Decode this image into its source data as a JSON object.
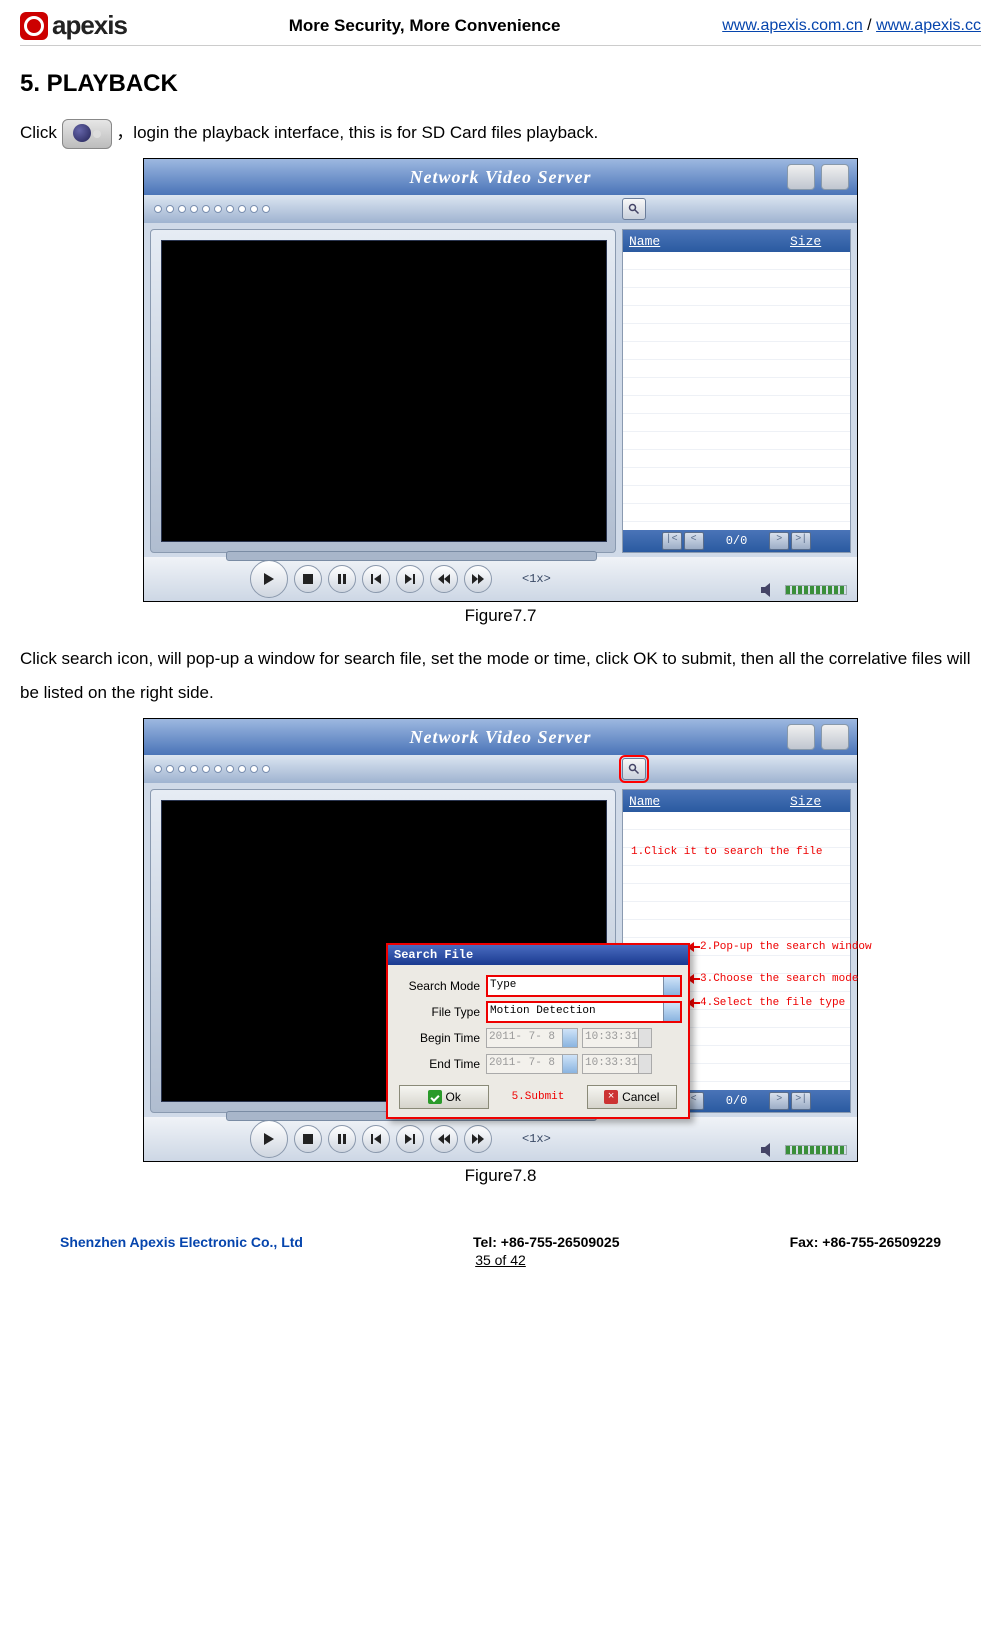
{
  "header": {
    "brand": "apexis",
    "slogan": "More Security, More Convenience",
    "link1": "www.apexis.com.cn",
    "sep": " / ",
    "link2": "www.apexis.cc"
  },
  "title": "5. PLAYBACK",
  "para1_pre": "Click",
  "para1_post": "，login the playback interface, this is for SD Card files playback.",
  "fig1": {
    "app_title": "Network Video Server",
    "col_name": "Name",
    "col_size": "Size",
    "pager": "0/0",
    "speed": "<1x>"
  },
  "caption1": "Figure7.7",
  "para2": "Click search icon, will pop-up a window for search file, set the mode or time, click OK to submit, then all the correlative files will be listed on the right side.",
  "fig2": {
    "app_title": "Network Video Server",
    "col_name": "Name",
    "col_size": "Size",
    "pager": "0/0",
    "speed": "<1x>",
    "annot1": "1.Click it to search the file",
    "annot2": "2.Pop-up the search window",
    "annot3": "3.Choose the search mode",
    "annot4": "4.Select the file type",
    "annot5": "5.Submit",
    "popup": {
      "title": "Search File",
      "row1_label": "Search Mode",
      "row1_value": "Type",
      "row2_label": "File Type",
      "row2_value": "Motion Detection",
      "row3_label": "Begin Time",
      "row3_date": "2011- 7- 8",
      "row3_time": "10:33:31",
      "row4_label": "End Time",
      "row4_date": "2011- 7- 8",
      "row4_time": "10:33:31",
      "ok": "Ok",
      "cancel": "Cancel"
    }
  },
  "caption2": "Figure7.8",
  "footer": {
    "company": "Shenzhen Apexis Electronic Co., Ltd",
    "tel": "Tel: +86-755-26509025",
    "fax": "Fax: +86-755-26509229",
    "page": "35 of 42"
  }
}
